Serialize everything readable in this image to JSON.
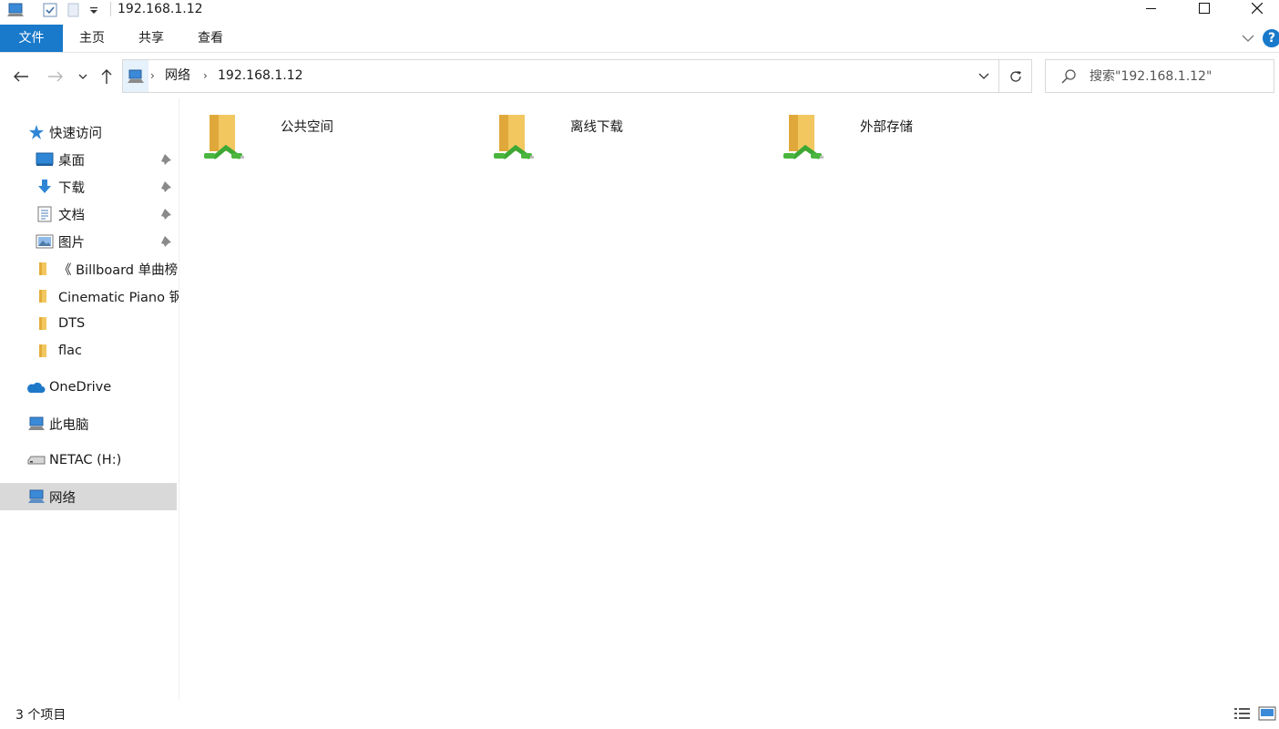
{
  "window": {
    "title": "192.168.1.12",
    "icons": [
      "computer-icon",
      "checkbox-icon",
      "folder-icon",
      "quick-access-dropdown-icon"
    ],
    "controls": [
      "minimize-icon",
      "maximize-icon",
      "close-icon"
    ]
  },
  "ribbon": {
    "tabs": [
      {
        "label": "文件",
        "active": true
      },
      {
        "label": "主页"
      },
      {
        "label": "共享"
      },
      {
        "label": "查看"
      }
    ],
    "help_label": "?",
    "accent_color": "#1979ca"
  },
  "address": {
    "breadcrumbs": [
      "网络",
      "192.168.1.12"
    ]
  },
  "search": {
    "placeholder": "搜索\"192.168.1.12\""
  },
  "sidebar": {
    "quick_access": {
      "label": "快速访问",
      "icon": "star-icon"
    },
    "pinned": [
      {
        "label": "桌面",
        "icon": "desktop-icon",
        "pinned": true
      },
      {
        "label": "下载",
        "icon": "download-arrow-icon",
        "pinned": true
      },
      {
        "label": "文档",
        "icon": "document-icon",
        "pinned": true
      },
      {
        "label": "图片",
        "icon": "pictures-icon",
        "pinned": true
      },
      {
        "label": "《 Billboard 单曲榜",
        "icon": "folder-icon"
      },
      {
        "label": "Cinematic Piano 钢",
        "icon": "folder-icon"
      },
      {
        "label": "DTS",
        "icon": "folder-icon"
      },
      {
        "label": "flac",
        "icon": "folder-icon"
      }
    ],
    "roots": [
      {
        "label": "OneDrive",
        "icon": "cloud-icon"
      },
      {
        "label": "此电脑",
        "icon": "computer-icon"
      },
      {
        "label": "NETAC (H:)",
        "icon": "drive-icon"
      },
      {
        "label": "网络",
        "icon": "network-icon",
        "selected": true
      }
    ]
  },
  "content": {
    "items": [
      {
        "label": "公共空间",
        "icon": "network-share-folder-icon"
      },
      {
        "label": "离线下载",
        "icon": "network-share-folder-icon"
      },
      {
        "label": "外部存储",
        "icon": "network-share-folder-icon"
      }
    ]
  },
  "status": {
    "item_count": "3 个项目",
    "views": [
      "details-view-icon",
      "large-icons-view-icon"
    ]
  }
}
